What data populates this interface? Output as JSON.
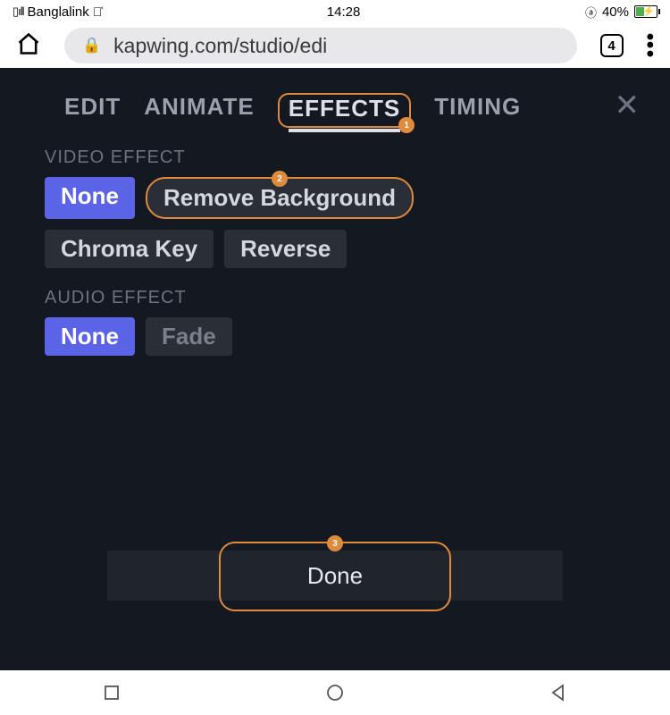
{
  "status": {
    "carrier": "Banglalink",
    "time": "14:28",
    "battery": "40%"
  },
  "browser": {
    "url": "kapwing.com/studio/edi",
    "tab_count": "4"
  },
  "tabs": {
    "edit": "EDIT",
    "animate": "ANIMATE",
    "effects": "EFFECTS",
    "timing": "TIMING"
  },
  "annotations": {
    "effects_badge": "1",
    "remove_bg_badge": "2",
    "done_badge": "3"
  },
  "sections": {
    "video_label": "VIDEO EFFECT",
    "audio_label": "AUDIO EFFECT"
  },
  "video_effects": {
    "none": "None",
    "remove_bg": "Remove Background",
    "chroma": "Chroma Key",
    "reverse": "Reverse"
  },
  "audio_effects": {
    "none": "None",
    "fade": "Fade"
  },
  "done_label": "Done"
}
